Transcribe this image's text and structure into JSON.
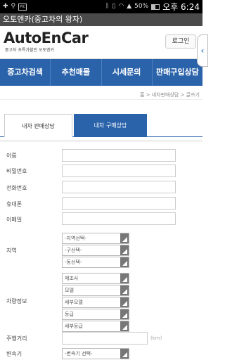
{
  "status_bar": {
    "time": "오후 6:24",
    "battery": "50%",
    "notif_box": "PIC",
    "icons": [
      "add-icon",
      "usb-icon",
      "image-icon",
      "bluetooth-icon",
      "vibrate-icon",
      "wifi-icon",
      "signal-icon"
    ]
  },
  "app_title": "오토엔카(중고차의 왕자)",
  "header": {
    "logo": "AutoEnCar",
    "tagline": "중고차 초특가할인 오토엔카",
    "login_label": "로그인",
    "side_handle": "‹"
  },
  "nav": [
    {
      "label": "중고차검색"
    },
    {
      "label": "추천매물"
    },
    {
      "label": "시세문의"
    },
    {
      "label": "판매구입상담"
    }
  ],
  "breadcrumb": "홈 > 내차판매상담 > 글쓰기",
  "tabs": {
    "active": "내차 판매상담",
    "inactive": "내차 구매상담"
  },
  "form": {
    "name_label": "이름",
    "password_label": "비밀번호",
    "phone_label": "전화번호",
    "mobile_label": "휴대폰",
    "email_label": "이메일",
    "region_label": "지역",
    "region_selects": [
      "-지역선택-",
      "-구선택-",
      "-동선택-"
    ],
    "car_info_label": "차량정보",
    "car_selects": [
      "제조사",
      "모델",
      "세부모델",
      "등급",
      "세부등급"
    ],
    "mileage_label": "주행거리",
    "mileage_unit": "(km)",
    "transmission_label": "변속기",
    "transmission_select": "-변속기 선택-"
  }
}
